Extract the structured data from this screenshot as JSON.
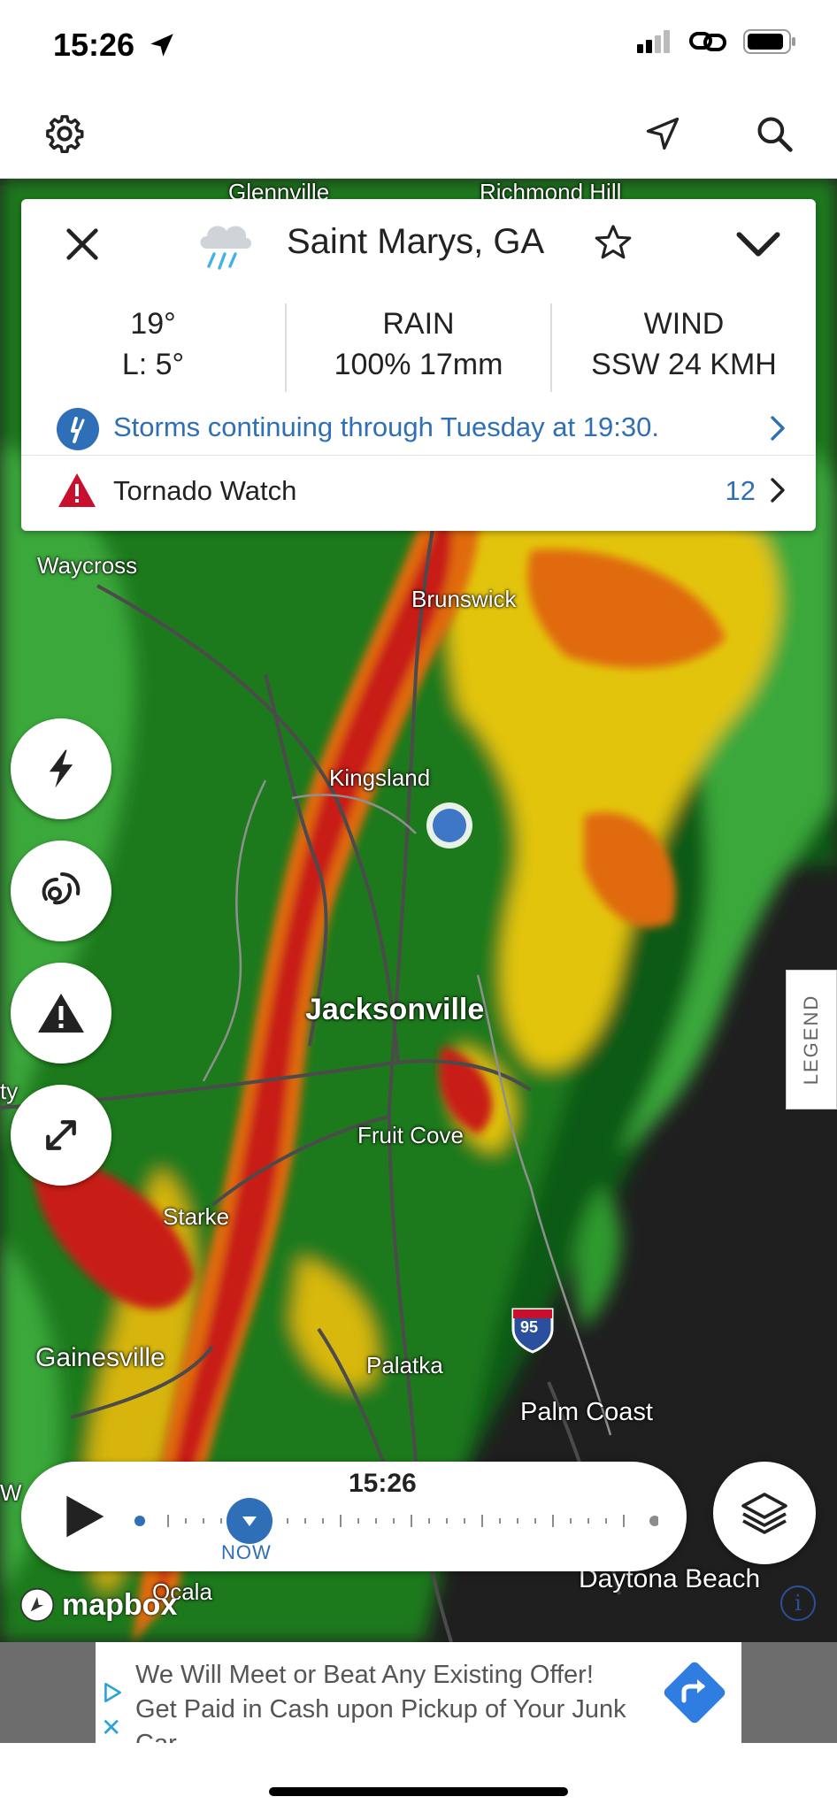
{
  "status_bar": {
    "time": "15:26"
  },
  "location": {
    "name": "Saint Marys, GA"
  },
  "stats": {
    "temp": {
      "line1": "19°",
      "line2": "L: 5°"
    },
    "rain": {
      "line1": "RAIN",
      "line2": "100% 17mm"
    },
    "wind": {
      "line1": "WIND",
      "line2": "SSW 24 KMH"
    }
  },
  "forecast": {
    "text": "Storms continuing through Tuesday at 19:30."
  },
  "alert": {
    "text": "Tornado Watch",
    "count": "12"
  },
  "map": {
    "labels": {
      "glennville": "Glennville",
      "richmond_hill": "Richmond Hill",
      "waycross": "Waycross",
      "brunswick": "Brunswick",
      "kingsland": "Kingsland",
      "jacksonville": "Jacksonville",
      "fruit_cove": "Fruit Cove",
      "starke": "Starke",
      "gainesville": "Gainesville",
      "palatka": "Palatka",
      "palm_coast": "Palm Coast",
      "daytona_beach": "Daytona Beach",
      "ocala": "Ocala",
      "edge_ty": "ty",
      "edge_w": "W"
    },
    "highway": "95",
    "attribution": "mapbox"
  },
  "legend": {
    "label": "LEGEND"
  },
  "timeline": {
    "time": "15:26",
    "now_label": "NOW"
  },
  "ad": {
    "text": "We Will Meet or Beat Any Existing Offer! Get Paid in Cash upon Pickup of Your Junk Car",
    "close": "✕"
  },
  "colors": {
    "accent": "#2f6fb8",
    "alert_red": "#c8102e",
    "radar_green": "#2e8b2e",
    "radar_red": "#c81e14",
    "radar_yellow": "#e8c410"
  },
  "icons": [
    "settings-icon",
    "navigation-arrow-icon",
    "search-icon",
    "close-icon",
    "rain-cloud-icon",
    "star-icon",
    "chevron-down-icon",
    "lightning-icon",
    "signal-icon",
    "warning-icon",
    "expand-icon",
    "play-icon",
    "layers-icon"
  ]
}
